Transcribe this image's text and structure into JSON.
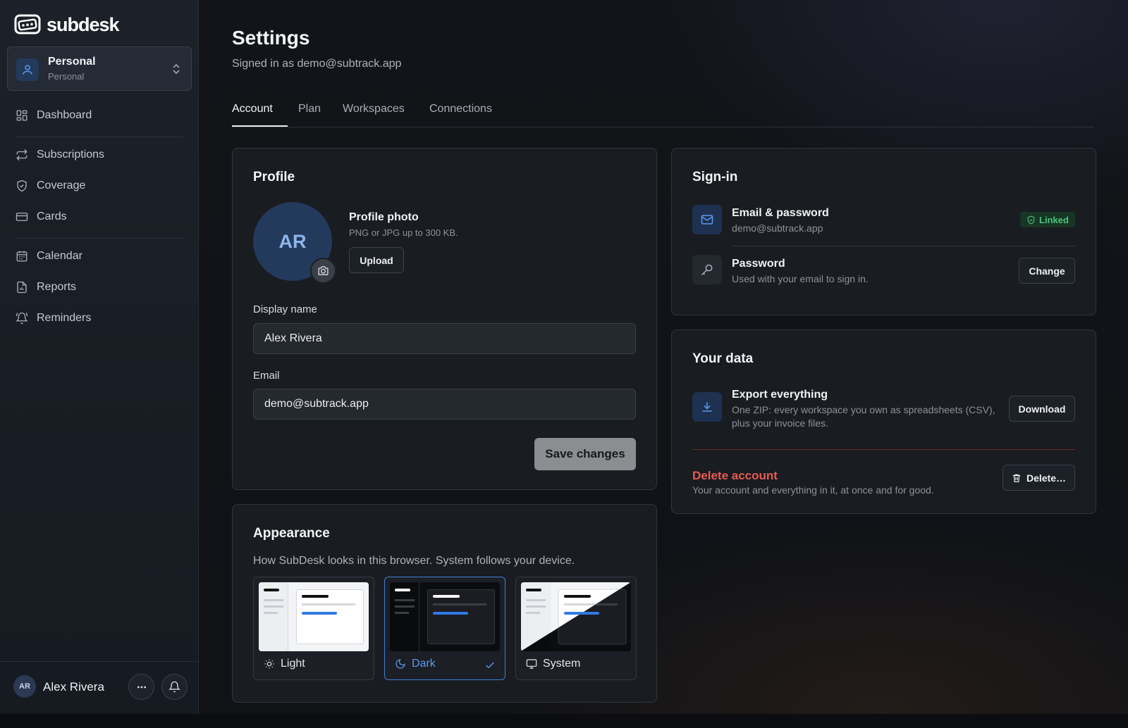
{
  "app": {
    "brand": "subdesk"
  },
  "workspace": {
    "name": "Personal",
    "subtitle": "Personal"
  },
  "sidebar": {
    "items": [
      {
        "label": "Dashboard",
        "icon": "grid-icon"
      },
      {
        "label": "Subscriptions",
        "icon": "repeat-icon"
      },
      {
        "label": "Coverage",
        "icon": "shield-icon"
      },
      {
        "label": "Cards",
        "icon": "credit-card-icon"
      },
      {
        "label": "Calendar",
        "icon": "calendar-icon"
      },
      {
        "label": "Reports",
        "icon": "report-icon"
      },
      {
        "label": "Reminders",
        "icon": "bell-ring-icon"
      }
    ]
  },
  "user": {
    "initials": "AR",
    "name": "Alex Rivera"
  },
  "header": {
    "title": "Settings",
    "subtitle": "Signed in as demo@subtrack.app"
  },
  "tabs": [
    {
      "label": "Account",
      "active": true
    },
    {
      "label": "Plan"
    },
    {
      "label": "Workspaces"
    },
    {
      "label": "Connections"
    }
  ],
  "profile": {
    "title": "Profile",
    "avatar_initials": "AR",
    "photo_title": "Profile photo",
    "photo_hint": "PNG or JPG up to 300 KB.",
    "upload_label": "Upload",
    "display_name_label": "Display name",
    "display_name_value": "Alex Rivera",
    "email_label": "Email",
    "email_value": "demo@subtrack.app",
    "save_label": "Save changes"
  },
  "appearance": {
    "title": "Appearance",
    "subtitle": "How SubDesk looks in this browser. System follows your device.",
    "options": [
      {
        "label": "Light",
        "icon": "sun-icon",
        "selected": false
      },
      {
        "label": "Dark",
        "icon": "moon-icon",
        "selected": true
      },
      {
        "label": "System",
        "icon": "monitor-icon",
        "selected": false
      }
    ]
  },
  "signin": {
    "title": "Sign-in",
    "email_method": {
      "title": "Email & password",
      "subtitle": "demo@subtrack.app",
      "badge": "Linked"
    },
    "password": {
      "title": "Password",
      "subtitle": "Used with your email to sign in.",
      "button": "Change"
    }
  },
  "your_data": {
    "title": "Your data",
    "export": {
      "title": "Export everything",
      "line1": "One ZIP: every workspace you own as spreadsheets (CSV),",
      "line2": "plus your invoice files.",
      "button": "Download"
    },
    "delete": {
      "title": "Delete account",
      "subtitle": "Your account and everything in it, at once and for good.",
      "button": "Delete…"
    }
  },
  "colors": {
    "accent": "#3f7fd8",
    "danger": "#e85a52",
    "success": "#4fc27e"
  }
}
